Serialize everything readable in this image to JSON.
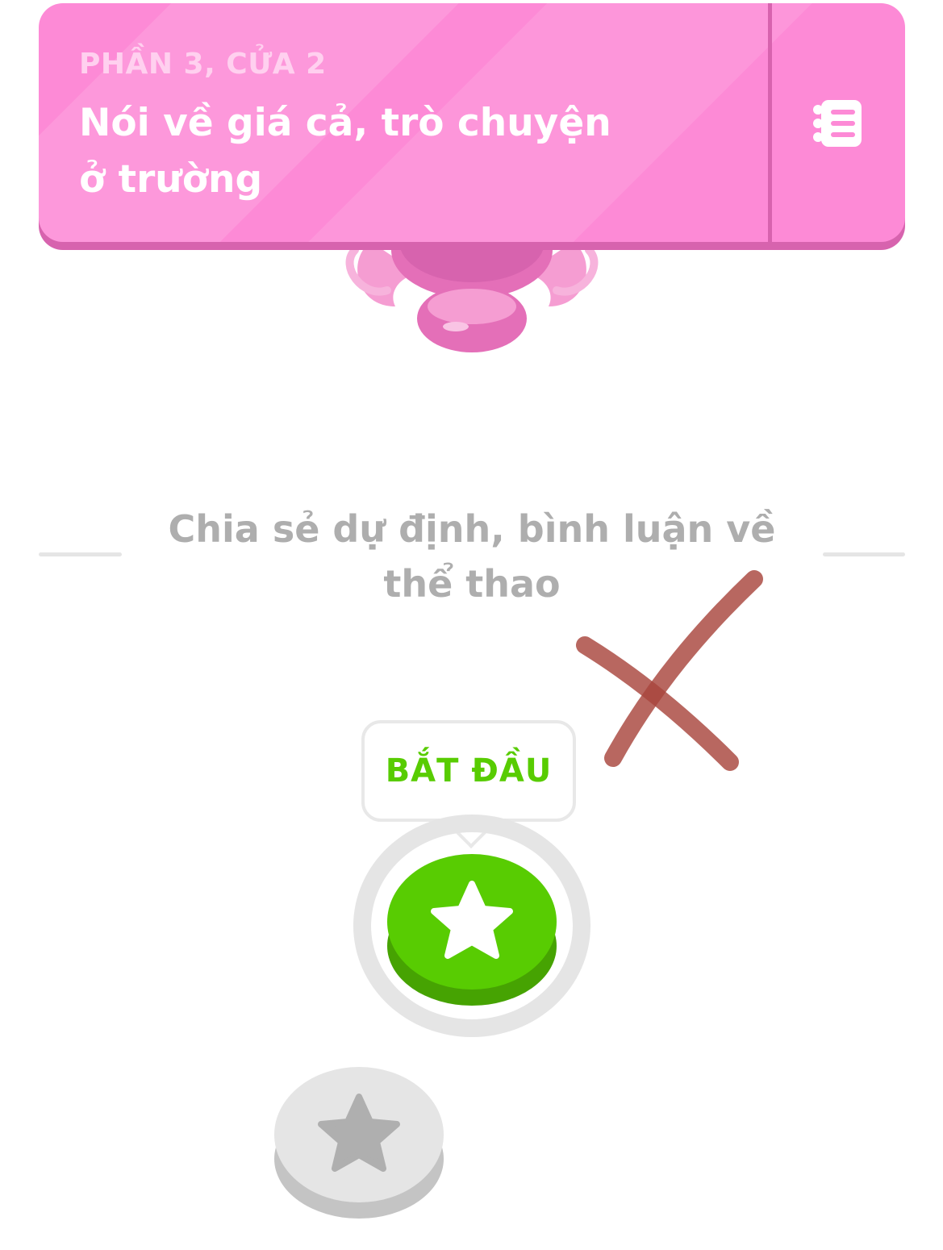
{
  "banner": {
    "section_label": "PHẦN 3, CỬA 2",
    "title": "Nói về giá cả, trò chuyện ở trường",
    "guide_icon": "guidebook-list-icon",
    "color": "#fd8ad6",
    "shadow_color": "#d763ae"
  },
  "trophy": {
    "icon": "trophy-icon",
    "color": "#e46fb8"
  },
  "divider": {
    "title": "Chia sẻ dự định, bình luận về thể thao"
  },
  "annotation": {
    "icon": "red-cross-mark-icon",
    "color": "#a8453d"
  },
  "start_tooltip": {
    "label": "BẮT ĐẦU"
  },
  "path_nodes": [
    {
      "state": "active",
      "icon": "star-icon",
      "color": "#58cc02"
    },
    {
      "state": "locked",
      "icon": "star-icon",
      "color": "#e5e5e5"
    }
  ]
}
